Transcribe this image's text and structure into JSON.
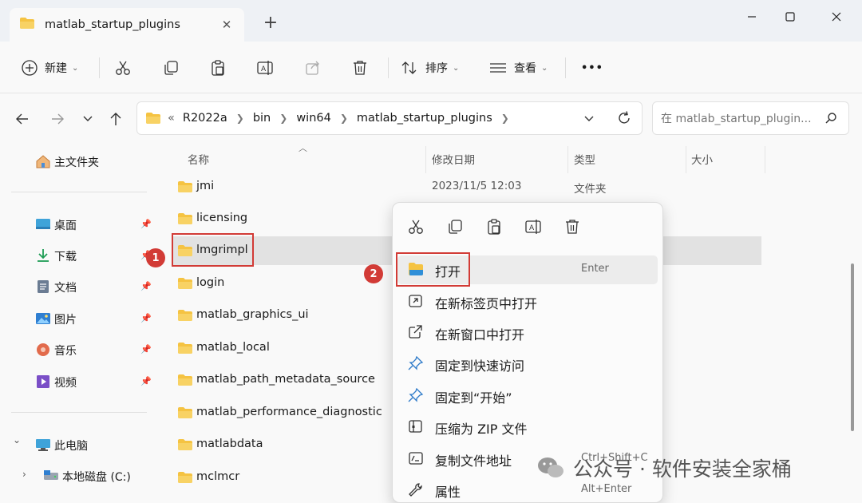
{
  "tab": {
    "title": "matlab_startup_plugins",
    "close": "✕",
    "new": "+"
  },
  "window": {
    "minimize": "—",
    "maximize": "☐",
    "close": "✕"
  },
  "toolbar": {
    "new_label": "新建",
    "sort_label": "排序",
    "view_label": "查看",
    "more": "•••"
  },
  "address": {
    "prefix": "«",
    "crumbs": [
      "R2022a",
      "bin",
      "win64",
      "matlab_startup_plugins"
    ],
    "search_placeholder": "在 matlab_startup_plugin..."
  },
  "sidebar": {
    "home": "主文件夹",
    "quick": [
      "桌面",
      "下载",
      "文档",
      "图片",
      "音乐",
      "视频"
    ],
    "this_pc": "此电脑",
    "drive": "本地磁盘 (C:)",
    "arrow_down": "⌄",
    "arrow_right": "›"
  },
  "columns": {
    "name": "名称",
    "date": "修改日期",
    "type": "类型",
    "size": "大小"
  },
  "files": [
    {
      "name": "jmi",
      "date": "2023/11/5 12:03",
      "type": "文件夹"
    },
    {
      "name": "licensing",
      "date": "",
      "type": ""
    },
    {
      "name": "lmgrimpl",
      "date": "",
      "type": ""
    },
    {
      "name": "login",
      "date": "",
      "type": ""
    },
    {
      "name": "matlab_graphics_ui",
      "date": "",
      "type": ""
    },
    {
      "name": "matlab_local",
      "date": "",
      "type": ""
    },
    {
      "name": "matlab_path_metadata_source",
      "date": "",
      "type": ""
    },
    {
      "name": "matlab_performance_diagnostic",
      "date": "",
      "type": ""
    },
    {
      "name": "matlabdata",
      "date": "",
      "type": ""
    },
    {
      "name": "mclmcr",
      "date": "",
      "type": ""
    }
  ],
  "badges": {
    "one": "1",
    "two": "2"
  },
  "context_menu": {
    "items": [
      {
        "label": "打开",
        "key": "Enter"
      },
      {
        "label": "在新标签页中打开",
        "key": ""
      },
      {
        "label": "在新窗口中打开",
        "key": ""
      },
      {
        "label": "固定到快速访问",
        "key": ""
      },
      {
        "label": "固定到“开始”",
        "key": ""
      },
      {
        "label": "压缩为 ZIP 文件",
        "key": ""
      },
      {
        "label": "复制文件地址",
        "key": "Ctrl+Shift+C"
      },
      {
        "label": "属性",
        "key": "Alt+Enter"
      }
    ]
  },
  "watermark": {
    "text": "公众号 · 软件安装全家桶"
  },
  "colors": {
    "accent": "#0067c0",
    "folder": "#f5c342",
    "highlight": "#d23b36"
  }
}
